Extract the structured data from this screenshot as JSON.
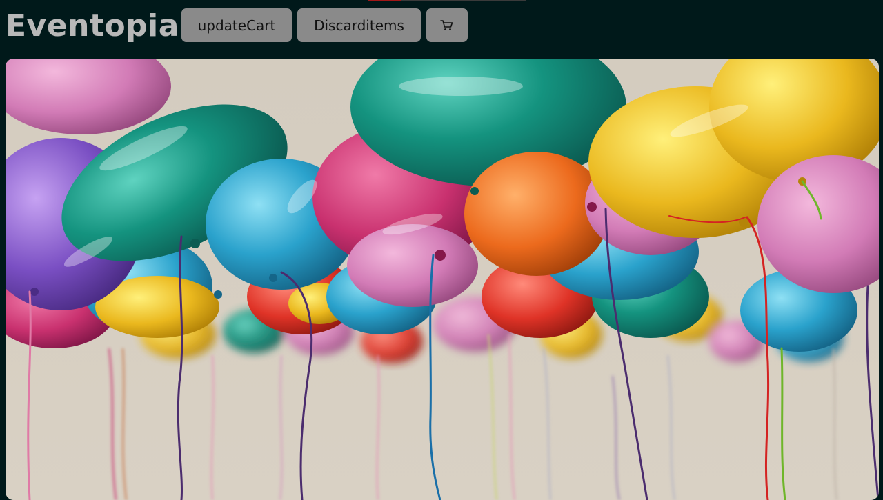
{
  "app": {
    "brand": "Eventopia"
  },
  "toolbar": {
    "update_label": "updateCart",
    "discard_label": "Discarditems",
    "cart_icon": "shopping-cart-icon"
  },
  "hero": {
    "subject": "party-balloons-image"
  },
  "colors": {
    "background": "#00191a",
    "button_bg": "#8a8a8a",
    "brand_text": "#b8b8b8"
  }
}
